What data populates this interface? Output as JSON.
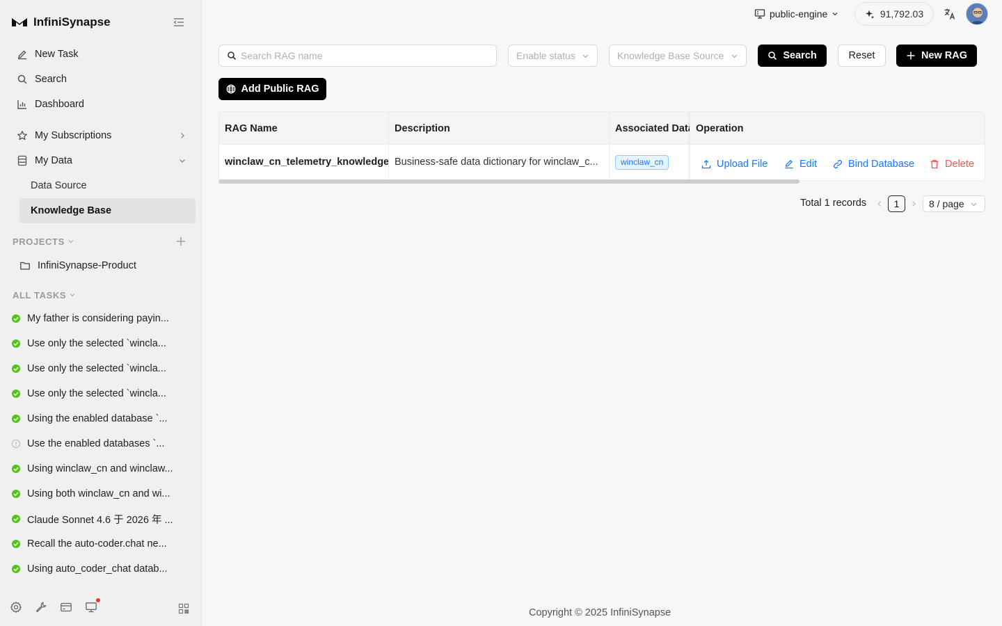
{
  "app": {
    "name": "InfiniSynapse"
  },
  "sidebar": {
    "nav": [
      {
        "label": "New Task",
        "icon": "pen-icon"
      },
      {
        "label": "Search",
        "icon": "search-icon"
      },
      {
        "label": "Dashboard",
        "icon": "chart-icon"
      }
    ],
    "my_subscriptions": "My Subscriptions",
    "my_data": "My Data",
    "data_source": "Data Source",
    "knowledge_base": "Knowledge Base",
    "projects_label": "PROJECTS",
    "project": "InfiniSynapse-Product",
    "all_tasks_label": "ALL TASKS",
    "tasks": [
      {
        "title": "My father is considering payin...",
        "status": "done"
      },
      {
        "title": "Use only the selected `wincla...",
        "status": "done"
      },
      {
        "title": "Use only the selected `wincla...",
        "status": "done"
      },
      {
        "title": "Use only the selected `wincla...",
        "status": "done"
      },
      {
        "title": "Using the enabled database `...",
        "status": "done"
      },
      {
        "title": "Use the enabled databases `...",
        "status": "pending"
      },
      {
        "title": "Using winclaw_cn and winclaw...",
        "status": "done"
      },
      {
        "title": "Using both winclaw_cn and wi...",
        "status": "done"
      },
      {
        "title": "Claude Sonnet 4.6 于 2026 年 ...",
        "status": "done"
      },
      {
        "title": "Recall the auto-coder.chat ne...",
        "status": "done"
      },
      {
        "title": "Using auto_coder_chat datab...",
        "status": "done"
      }
    ],
    "status_colors": {
      "done": "#52c41a",
      "pending": "#bfbfbf"
    }
  },
  "topbar": {
    "engine": "public-engine",
    "credits": "91,792.03"
  },
  "filters": {
    "search_placeholder": "Search RAG name",
    "enable_status": "Enable status",
    "kb_source": "Knowledge Base Source",
    "search_btn": "Search",
    "reset_btn": "Reset",
    "new_rag_btn": "New RAG",
    "add_public_btn": "Add Public RAG"
  },
  "table": {
    "columns": [
      "RAG Name",
      "Description",
      "Associated Data",
      "Operation"
    ],
    "rows": [
      {
        "name": "winclaw_cn_telemetry_knowledge",
        "description": "Business-safe data dictionary for winclaw_c...",
        "associated": "winclaw_cn",
        "ops": [
          "Upload File",
          "Edit",
          "Bind Database",
          "Delete"
        ]
      }
    ]
  },
  "pagination": {
    "total": "Total 1 records",
    "current": "1",
    "page_size": "8 / page"
  },
  "footer": {
    "copyright": "Copyright © 2025 InfiniSynapse"
  },
  "colors": {
    "accent": "#1677ff",
    "danger": "#ff4d4f",
    "primary_btn": "#000000"
  }
}
